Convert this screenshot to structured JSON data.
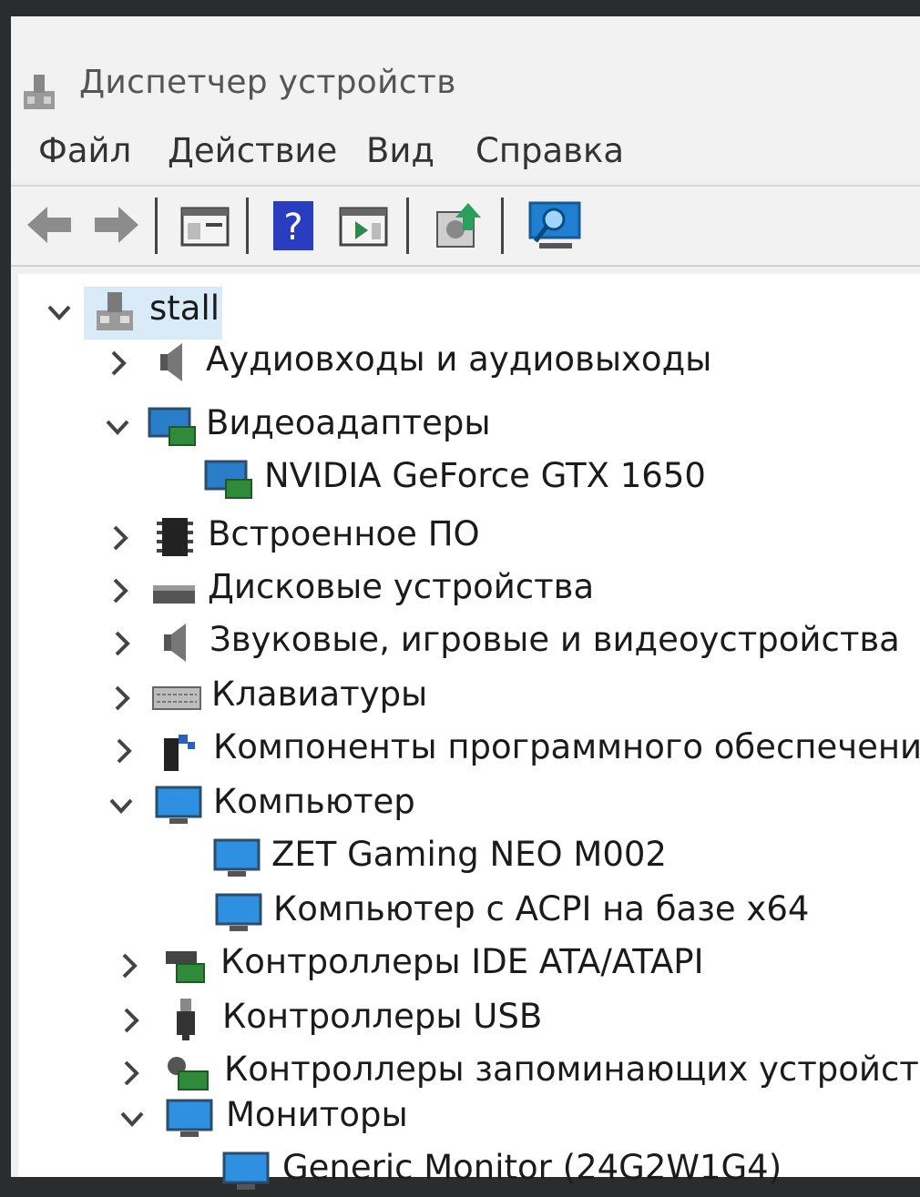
{
  "window": {
    "title": "Диспетчер устройств"
  },
  "menu": [
    {
      "label": "Файл"
    },
    {
      "label": "Действие"
    },
    {
      "label": "Вид"
    },
    {
      "label": "Справка"
    }
  ],
  "toolbar": {
    "buttons": [
      "back-arrow-icon",
      "forward-arrow-icon",
      "properties-icon",
      "help-icon",
      "run-icon",
      "update-driver-icon",
      "scan-hardware-icon"
    ]
  },
  "tree": {
    "root": {
      "label": "stall",
      "icon": "computer-tower-icon"
    },
    "items": [
      {
        "label": "Аудиовходы и аудиовыходы",
        "expanded": false,
        "icon": "speaker-icon"
      },
      {
        "label": "Видеоадаптеры",
        "expanded": true,
        "icon": "display-adapter-icon",
        "children": [
          {
            "label": "NVIDIA GeForce GTX 1650",
            "icon": "display-adapter-icon"
          }
        ]
      },
      {
        "label": "Встроенное ПО",
        "expanded": false,
        "icon": "chip-icon"
      },
      {
        "label": "Дисковые устройства",
        "expanded": false,
        "icon": "disk-drive-icon"
      },
      {
        "label": "Звуковые, игровые и видеоустройства",
        "expanded": false,
        "icon": "speaker-icon"
      },
      {
        "label": "Клавиатуры",
        "expanded": false,
        "icon": "keyboard-icon"
      },
      {
        "label": "Компоненты программного обеспечения",
        "expanded": false,
        "icon": "software-component-icon"
      },
      {
        "label": "Компьютер",
        "expanded": true,
        "icon": "monitor-icon",
        "children": [
          {
            "label": "ZET Gaming NEO M002",
            "icon": "monitor-icon"
          },
          {
            "label": "Компьютер с ACPI на базе x64",
            "icon": "monitor-icon"
          }
        ]
      },
      {
        "label": "Контроллеры IDE ATA/ATAPI",
        "expanded": false,
        "icon": "ide-controller-icon"
      },
      {
        "label": "Контроллеры USB",
        "expanded": false,
        "icon": "usb-icon"
      },
      {
        "label": "Контроллеры запоминающих устройств",
        "expanded": false,
        "icon": "storage-controller-icon"
      },
      {
        "label": "Мониторы",
        "expanded": true,
        "icon": "monitor-icon",
        "children": [
          {
            "label": "Generic Monitor (24G2W1G4)",
            "icon": "monitor-icon"
          }
        ]
      }
    ]
  }
}
